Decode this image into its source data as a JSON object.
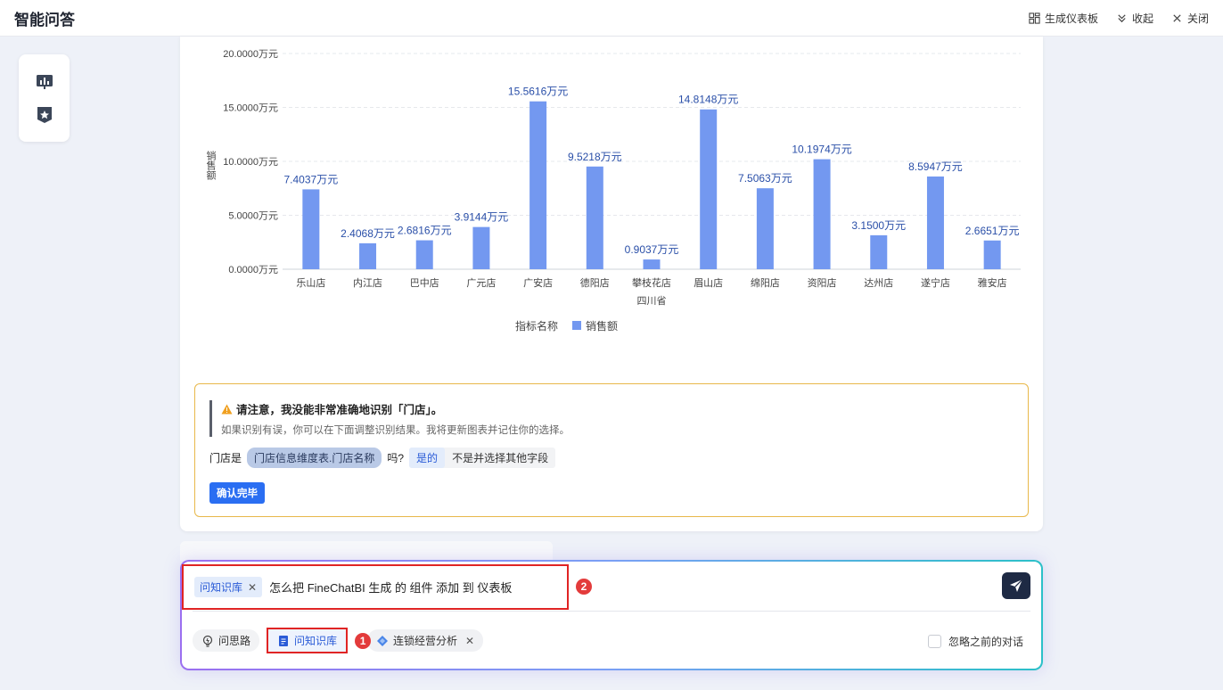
{
  "header": {
    "title": "智能问答",
    "actions": [
      "生成仪表板",
      "收起",
      "关闭"
    ]
  },
  "side_tools": [
    "chart-board-icon",
    "star-badge-icon"
  ],
  "chart_data": {
    "type": "bar",
    "categories": [
      "乐山店",
      "内江店",
      "巴中店",
      "广元店",
      "广安店",
      "德阳店",
      "攀枝花店",
      "眉山店",
      "绵阳店",
      "资阳店",
      "达州店",
      "遂宁店",
      "雅安店"
    ],
    "group_label": "四川省",
    "series": [
      {
        "name": "销售额",
        "values": [
          7.4037,
          2.4068,
          2.6816,
          3.9144,
          15.5616,
          9.5218,
          0.9037,
          14.8148,
          7.5063,
          10.1974,
          3.15,
          8.5947,
          2.6651
        ]
      }
    ],
    "data_labels": [
      "7.4037万元",
      "2.4068万元",
      "2.6816万元",
      "3.9144万元",
      "15.5616万元",
      "9.5218万元",
      "0.9037万元",
      "14.8148万元",
      "7.5063万元",
      "10.1974万元",
      "3.1500万元",
      "8.5947万元",
      "2.6651万元"
    ],
    "y_ticks": [
      "0.0000万元",
      "5.0000万元",
      "10.0000万元",
      "15.0000万元",
      "20.0000万元"
    ],
    "ylim": [
      0,
      20
    ],
    "ylabel": "销售额",
    "legend_title": "指标名称",
    "legend_placement": "bottom-center",
    "grid": true,
    "bar_color": "#7398f0",
    "label_color": "#2a4fa8"
  },
  "notice": {
    "icon": "warning-icon",
    "title": "请注意，我没能非常准确地识别「门店」。",
    "subtitle": "如果识别有误，你可以在下面调整识别结果。我将更新图表并记住你的选择。",
    "prefix": "门店是",
    "field": "门店信息维度表.门店名称",
    "question": "吗?",
    "option_yes": "是的",
    "option_other": "不是并选择其他字段",
    "confirm": "确认完毕"
  },
  "input": {
    "chip_label": "问知识库",
    "query": "怎么把 FineChatBI 生成 的 组件 添加  到 仪表板",
    "badge_query": "2",
    "badge_tool": "1",
    "tools": [
      {
        "label": "问思路",
        "icon": "lightbulb-icon"
      },
      {
        "label": "问知识库",
        "icon": "document-icon"
      },
      {
        "label": "连锁经营分析",
        "icon": "diamond-icon"
      }
    ],
    "ignore_label": "忽略之前的对话"
  }
}
